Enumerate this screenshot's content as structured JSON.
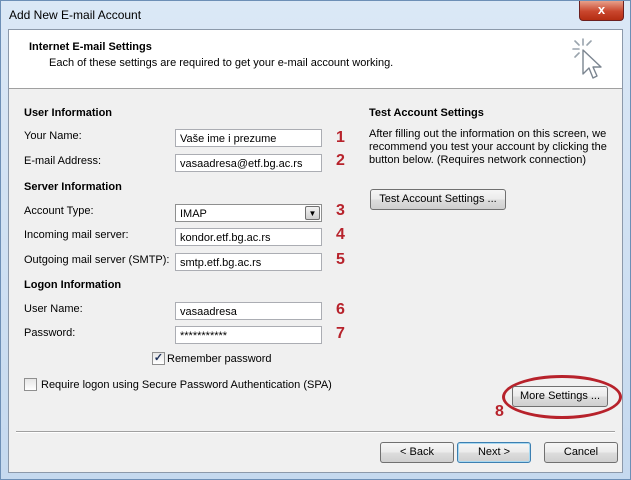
{
  "window": {
    "title": "Add New E-mail Account",
    "close_label": "x"
  },
  "header": {
    "title": "Internet E-mail Settings",
    "subtitle": "Each of these settings are required to get your e-mail account working.",
    "icon": "mouse-cursor-click-icon"
  },
  "user_info": {
    "heading": "User Information",
    "name_label": "Your Name:",
    "name_value": "Vaše ime i prezume",
    "email_label": "E-mail Address:",
    "email_value": "vasaadresa@etf.bg.ac.rs"
  },
  "server_info": {
    "heading": "Server Information",
    "account_type_label": "Account Type:",
    "account_type_value": "IMAP",
    "incoming_label": "Incoming mail server:",
    "incoming_value": "kondor.etf.bg.ac.rs",
    "outgoing_label": "Outgoing mail server (SMTP):",
    "outgoing_value": "smtp.etf.bg.ac.rs"
  },
  "logon_info": {
    "heading": "Logon Information",
    "username_label": "User Name:",
    "username_value": "vasaadresa",
    "password_label": "Password:",
    "password_value": "***********",
    "remember_label": "Remember password",
    "remember_checked": true,
    "spa_label": "Require logon using Secure Password Authentication (SPA)",
    "spa_checked": false
  },
  "test_settings": {
    "heading": "Test Account Settings",
    "description": "After filling out the information on this screen, we recommend you test your account by clicking the button below. (Requires network connection)",
    "button_label": "Test Account Settings ..."
  },
  "more_settings_label": "More Settings ...",
  "annotations": {
    "n1": "1",
    "n2": "2",
    "n3": "3",
    "n4": "4",
    "n5": "5",
    "n6": "6",
    "n7": "7",
    "n8": "8",
    "color": "#b7222b"
  },
  "footer": {
    "back_label": "< Back",
    "next_label": "Next >",
    "cancel_label": "Cancel"
  }
}
